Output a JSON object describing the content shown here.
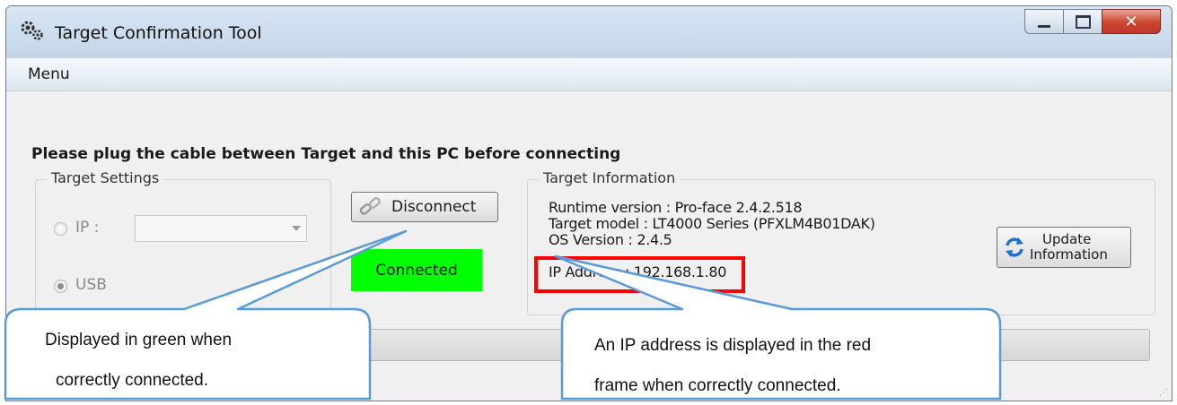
{
  "window": {
    "title": "Target Confirmation Tool"
  },
  "menu": {
    "items": [
      "Menu"
    ]
  },
  "notice": "Please plug the cable between Target and this PC before connecting",
  "target_settings": {
    "label": "Target Settings",
    "ip_label": "IP :",
    "ip_value": "",
    "usb_label": "USB",
    "selected": "USB"
  },
  "connection": {
    "disconnect_label": "Disconnect",
    "status": "Connected",
    "status_color": "#00ff00"
  },
  "target_info": {
    "label": "Target Information",
    "runtime": "Runtime version : Pro-face 2.4.2.518",
    "model": "Target model : LT4000 Series (PFXLM4B01DAK)",
    "os": "OS Version : 2.4.5",
    "ip": "IP Address : 192.168.1.80",
    "update_label_1": "Update",
    "update_label_2": "Information"
  },
  "callouts": {
    "green_1": "Displayed in green when",
    "green_2": "correctly connected.",
    "red_1": "An IP address is displayed in the red",
    "red_2": "frame when correctly connected."
  },
  "colors": {
    "highlight_frame": "#ff0000",
    "callout_border": "#5b9bd5"
  }
}
